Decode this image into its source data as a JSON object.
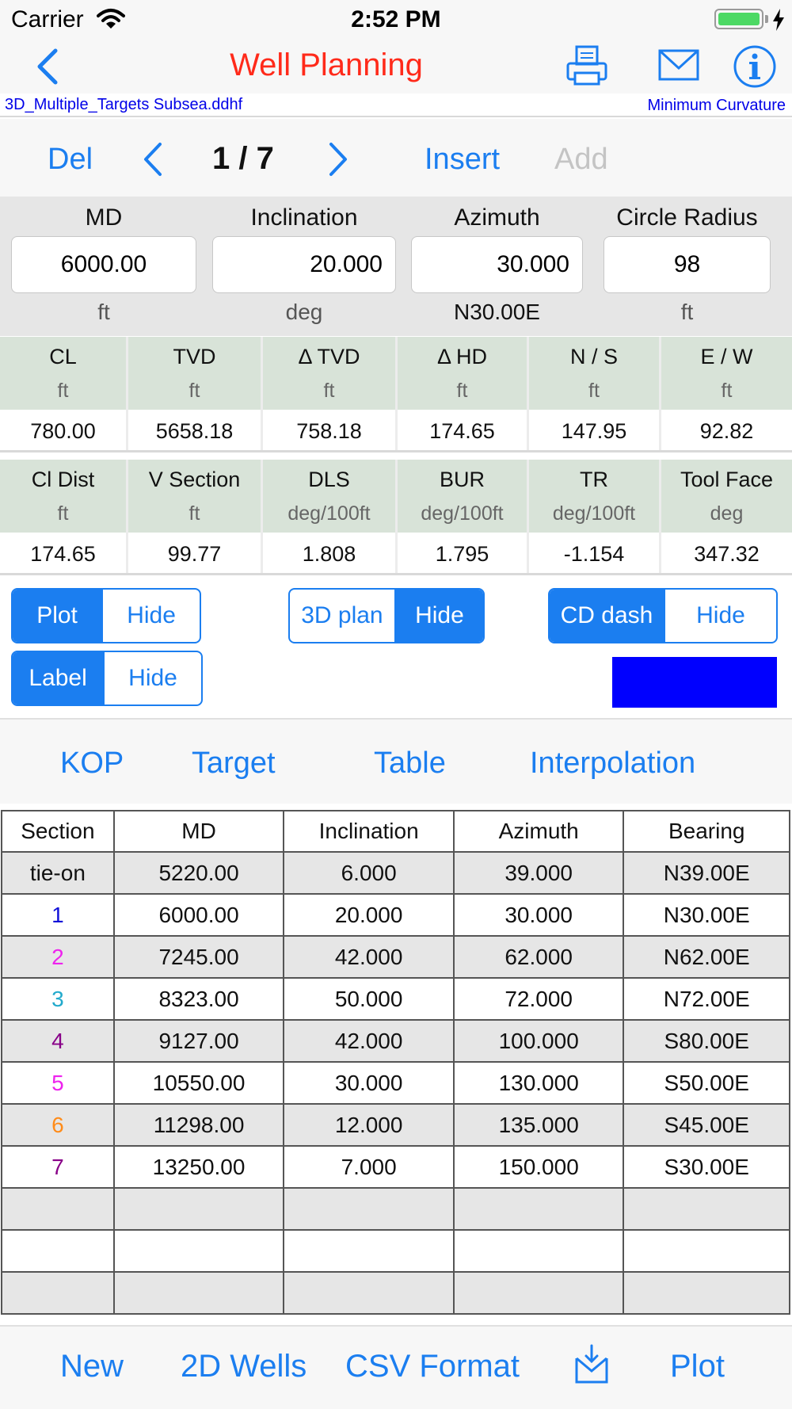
{
  "status": {
    "carrier": "Carrier",
    "time": "2:52 PM"
  },
  "nav": {
    "title": "Well Planning",
    "title_color": "#ff2a1a",
    "icons": [
      "back-chevron-icon",
      "printer-icon",
      "mail-icon",
      "info-icon"
    ]
  },
  "file": {
    "name": "3D_Multiple_Targets Subsea.ddhf",
    "method": "Minimum Curvature"
  },
  "pager": {
    "del": "Del",
    "count": "1 / 7",
    "insert": "Insert",
    "add": "Add"
  },
  "inputs": {
    "md": {
      "label": "MD",
      "value": "6000.00",
      "unit": "ft"
    },
    "inclination": {
      "label": "Inclination",
      "value": "20.000",
      "unit": "deg"
    },
    "azimuth": {
      "label": "Azimuth",
      "value": "30.000",
      "unit": "N30.00E"
    },
    "radius": {
      "label": "Circle Radius",
      "value": "98",
      "unit": "ft"
    }
  },
  "results1": [
    {
      "name": "CL",
      "unit": "ft",
      "value": "780.00"
    },
    {
      "name": "TVD",
      "unit": "ft",
      "value": "5658.18"
    },
    {
      "name": "Δ TVD",
      "unit": "ft",
      "value": "758.18"
    },
    {
      "name": "Δ HD",
      "unit": "ft",
      "value": "174.65"
    },
    {
      "name": "N / S",
      "unit": "ft",
      "value": "147.95"
    },
    {
      "name": "E / W",
      "unit": "ft",
      "value": "92.82"
    }
  ],
  "results2": [
    {
      "name": "Cl Dist",
      "unit": "ft",
      "value": "174.65"
    },
    {
      "name": "V Section",
      "unit": "ft",
      "value": "99.77"
    },
    {
      "name": "DLS",
      "unit": "deg/100ft",
      "value": "1.808"
    },
    {
      "name": "BUR",
      "unit": "deg/100ft",
      "value": "1.795"
    },
    {
      "name": "TR",
      "unit": "deg/100ft",
      "value": "-1.154"
    },
    {
      "name": "Tool Face",
      "unit": "deg",
      "value": "347.32"
    }
  ],
  "toggles": {
    "plot": {
      "on": "Plot",
      "off": "Hide"
    },
    "plan": {
      "on": "3D plan",
      "off": "Hide"
    },
    "cd": {
      "on": "CD dash",
      "off": "Hide"
    },
    "label": {
      "on": "Label",
      "off": "Hide"
    },
    "line_color": "#0000ff"
  },
  "links": {
    "kop": "KOP",
    "target": "Target",
    "table": "Table",
    "interpolation": "Interpolation"
  },
  "table": {
    "headers": [
      "Section",
      "MD",
      "Inclination",
      "Azimuth",
      "Bearing"
    ],
    "rows": [
      {
        "section": "tie-on",
        "md": "5220.00",
        "inc": "6.000",
        "azi": "39.000",
        "bearing": "N39.00E",
        "color": "#111111"
      },
      {
        "section": "1",
        "md": "6000.00",
        "inc": "20.000",
        "azi": "30.000",
        "bearing": "N30.00E",
        "color": "#1010d8"
      },
      {
        "section": "2",
        "md": "7245.00",
        "inc": "42.000",
        "azi": "62.000",
        "bearing": "N62.00E",
        "color": "#ee22ee"
      },
      {
        "section": "3",
        "md": "8323.00",
        "inc": "50.000",
        "azi": "72.000",
        "bearing": "N72.00E",
        "color": "#22aacc"
      },
      {
        "section": "4",
        "md": "9127.00",
        "inc": "42.000",
        "azi": "100.000",
        "bearing": "S80.00E",
        "color": "#880088"
      },
      {
        "section": "5",
        "md": "10550.00",
        "inc": "30.000",
        "azi": "130.000",
        "bearing": "S50.00E",
        "color": "#ee22ee"
      },
      {
        "section": "6",
        "md": "11298.00",
        "inc": "12.000",
        "azi": "135.000",
        "bearing": "S45.00E",
        "color": "#ff8c1a"
      },
      {
        "section": "7",
        "md": "13250.00",
        "inc": "7.000",
        "azi": "150.000",
        "bearing": "S30.00E",
        "color": "#880088"
      }
    ]
  },
  "tabs": {
    "new": "New",
    "wells": "2D Wells",
    "csv": "CSV Format",
    "plot": "Plot",
    "export_icon": "export-tray-icon"
  },
  "colors": {
    "accent": "#1b7ef0",
    "header_green": "#d8e3d8",
    "file_text": "#0000e8"
  }
}
